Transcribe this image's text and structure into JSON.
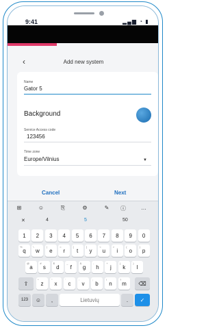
{
  "status": {
    "time": "9:41",
    "icons": "▂▄▆ ◔ ▮"
  },
  "header": {
    "back_icon": "chevron-left-icon",
    "title": "Add new system"
  },
  "form": {
    "name": {
      "label": "Name",
      "value": "Gator 5"
    },
    "background": {
      "label": "Background",
      "color": "#2f86c9"
    },
    "service_code": {
      "label": "Service Access code",
      "value": "123456"
    },
    "timezone": {
      "label": "Time zone",
      "value": "Europe/Vilnius"
    }
  },
  "actions": {
    "cancel": "Cancel",
    "next": "Next"
  },
  "accent": "#1f6fbf",
  "keyboard": {
    "toolbar": [
      "⊞",
      "☺",
      "⎘",
      "⚙",
      "✎",
      "ⓘ",
      "…"
    ],
    "suggestions": [
      "✕",
      "4",
      "5",
      "50"
    ],
    "numbers": [
      "1",
      "2",
      "3",
      "4",
      "5",
      "6",
      "7",
      "8",
      "9",
      "0"
    ],
    "row1": [
      "q",
      "w",
      "e",
      "r",
      "t",
      "y",
      "u",
      "i",
      "o",
      "p"
    ],
    "row1_sup": [
      "%",
      "\\",
      "|",
      "=",
      "[",
      "]",
      "<",
      ">",
      "{",
      "}"
    ],
    "row2": [
      "a",
      "s",
      "d",
      "f",
      "g",
      "h",
      "j",
      "k",
      "l"
    ],
    "row2_sup": [
      "@",
      "#",
      "$",
      "_",
      "&",
      "-",
      "+",
      "(",
      ")"
    ],
    "row3": [
      "z",
      "x",
      "c",
      "v",
      "b",
      "n",
      "m"
    ],
    "row3_sup": [
      "*",
      "\"",
      "'",
      ":",
      ";",
      "!",
      "?"
    ],
    "shift": "⇧",
    "backspace": "⌫",
    "sym": "123",
    "emoji": "☺",
    "comma": ",",
    "space": "Lietuvių",
    "period": ".",
    "enter": "✓"
  }
}
